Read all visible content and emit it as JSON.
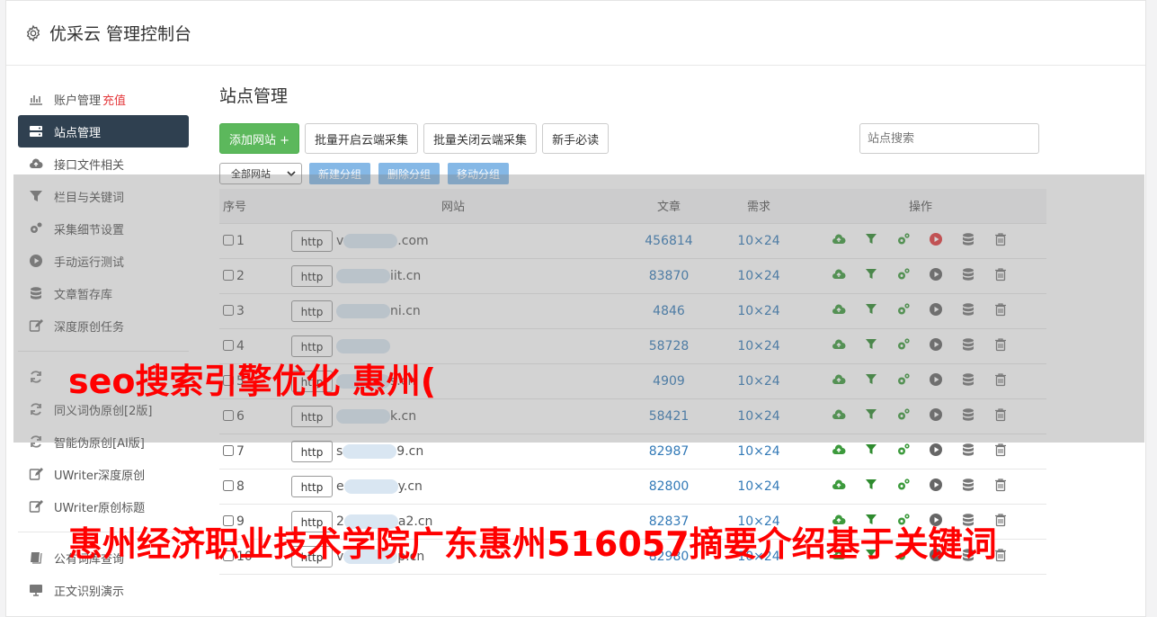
{
  "header": {
    "title": "优采云 管理控制台"
  },
  "sidebar": {
    "items": [
      {
        "label": "账户管理",
        "badge": "充值"
      },
      {
        "label": "站点管理"
      },
      {
        "label": "接口文件相关"
      },
      {
        "label": "栏目与关键词"
      },
      {
        "label": "采集细节设置"
      },
      {
        "label": "手动运行测试"
      },
      {
        "label": "文章暂存库"
      },
      {
        "label": "深度原创任务"
      },
      {
        "label": "同义词伪原创[2版]"
      },
      {
        "label": "智能伪原创[AI版]"
      },
      {
        "label": "UWriter深度原创"
      },
      {
        "label": "UWriter原创标题"
      },
      {
        "label": "公有词库查询"
      },
      {
        "label": "正文识别演示"
      }
    ]
  },
  "main": {
    "title": "站点管理",
    "toolbar": {
      "add_site": "添加网站 +",
      "batch_open": "批量开启云端采集",
      "batch_close": "批量关闭云端采集",
      "guide": "新手必读",
      "search_placeholder": "站点搜索"
    },
    "group": {
      "select": "全部网站",
      "new_group": "新建分组",
      "delete_group": "删除分组",
      "move_group": "移动分组"
    },
    "table": {
      "headers": [
        "序号",
        "网站",
        "文章",
        "需求",
        "操作"
      ],
      "rows": [
        {
          "seq": "1",
          "proto": "http",
          "site_prefix": "v",
          "site_suffix": ".com",
          "articles": "456814",
          "demand": "10×24"
        },
        {
          "seq": "2",
          "proto": "http",
          "site_prefix": "",
          "site_suffix": "iit.cn",
          "articles": "83870",
          "demand": "10×24"
        },
        {
          "seq": "3",
          "proto": "http",
          "site_prefix": "",
          "site_suffix": "ni.cn",
          "articles": "4846",
          "demand": "10×24"
        },
        {
          "seq": "4",
          "proto": "http",
          "site_prefix": "",
          "site_suffix": "",
          "articles": "58728",
          "demand": "10×24"
        },
        {
          "seq": "5",
          "proto": "http",
          "site_prefix": "",
          "site_suffix": "s.cn",
          "articles": "4909",
          "demand": "10×24"
        },
        {
          "seq": "6",
          "proto": "http",
          "site_prefix": "",
          "site_suffix": "k.cn",
          "articles": "58421",
          "demand": "10×24"
        },
        {
          "seq": "7",
          "proto": "http",
          "site_prefix": "s",
          "site_suffix": "9.cn",
          "articles": "82987",
          "demand": "10×24"
        },
        {
          "seq": "8",
          "proto": "http",
          "site_prefix": "e",
          "site_suffix": "y.cn",
          "articles": "82800",
          "demand": "10×24"
        },
        {
          "seq": "9",
          "proto": "http",
          "site_prefix": "2",
          "site_suffix": "a2.cn",
          "articles": "82837",
          "demand": "10×24"
        },
        {
          "seq": "10",
          "proto": "http",
          "site_prefix": "v",
          "site_suffix": "p.cn",
          "articles": "82980",
          "demand": "10×24"
        }
      ]
    }
  },
  "overlay_text": {
    "line1": "seo搜索引擎优化 惠州(",
    "line2": "惠州经济职业技术学院广东惠州516057摘要介绍基于关键词"
  },
  "colors": {
    "accent": "#2f4050",
    "green": "#5cb85c",
    "blue": "#85b8e6",
    "link": "#337ab7",
    "spam": "#ff0000"
  }
}
